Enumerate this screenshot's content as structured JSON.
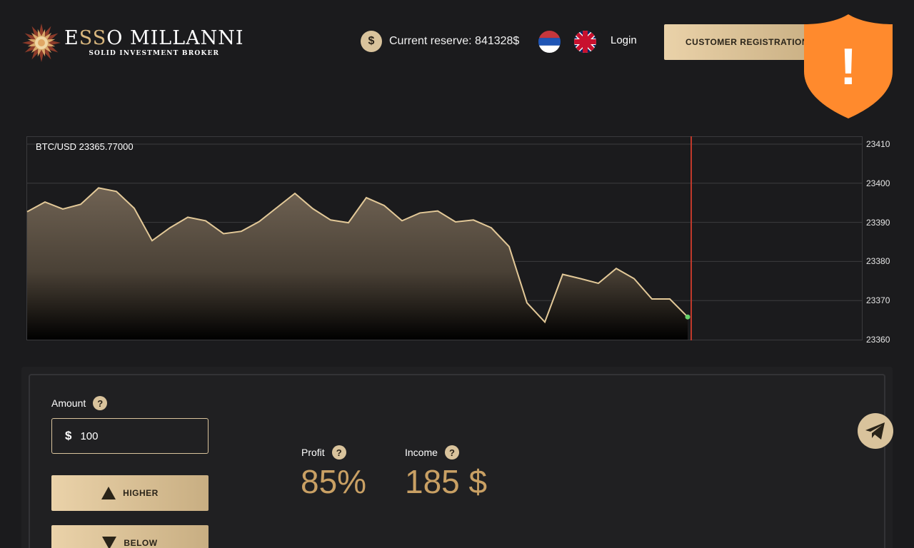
{
  "header": {
    "logo": {
      "name_prefix": "E",
      "name_accent": "SS",
      "name_rest": "O MILLANNI",
      "tagline": "SOLID INVESTMENT BROKER"
    },
    "reserve": {
      "icon": "dollar-coin-icon",
      "text": "Current reserve: 841328$"
    },
    "languages": [
      "serbian-flag-icon",
      "uk-flag-icon"
    ],
    "login_label": "Login",
    "register_label": "CUSTOMER REGISTRATION",
    "alert_icon": "warning-shield-icon",
    "alert_symbol": "!"
  },
  "chart_data": {
    "type": "area",
    "title": "BTC/USD 23365.77000",
    "ylim": [
      23360,
      23412
    ],
    "y_ticks": [
      23410,
      23400,
      23390,
      23380,
      23370,
      23360
    ],
    "grid": true,
    "values": [
      23392.7,
      23395.2,
      23393.4,
      23394.6,
      23398.8,
      23397.9,
      23393.6,
      23385.3,
      23388.6,
      23391.3,
      23390.4,
      23387.1,
      23387.7,
      23390.2,
      23393.8,
      23397.4,
      23393.5,
      23390.6,
      23389.9,
      23396.3,
      23394.3,
      23390.4,
      23392.4,
      23392.9,
      23390.1,
      23390.6,
      23388.6,
      23383.8,
      23369.4,
      23364.5,
      23376.7,
      23375.6,
      23374.4,
      23378.2,
      23375.6,
      23370.4,
      23370.4,
      23365.8
    ],
    "line_color": "#e3c998",
    "marker_color": "#c0392b",
    "last_point_color": "#6ad36a"
  },
  "panel": {
    "amount_label": "Amount",
    "amount_currency": "$",
    "amount_value": "100",
    "help_symbol": "?",
    "higher_label": "HIGHER",
    "below_label": "BELOW",
    "profit_label": "Profit",
    "profit_value": "85%",
    "income_label": "Income",
    "income_value": "185 $",
    "telegram_icon": "telegram-icon"
  }
}
